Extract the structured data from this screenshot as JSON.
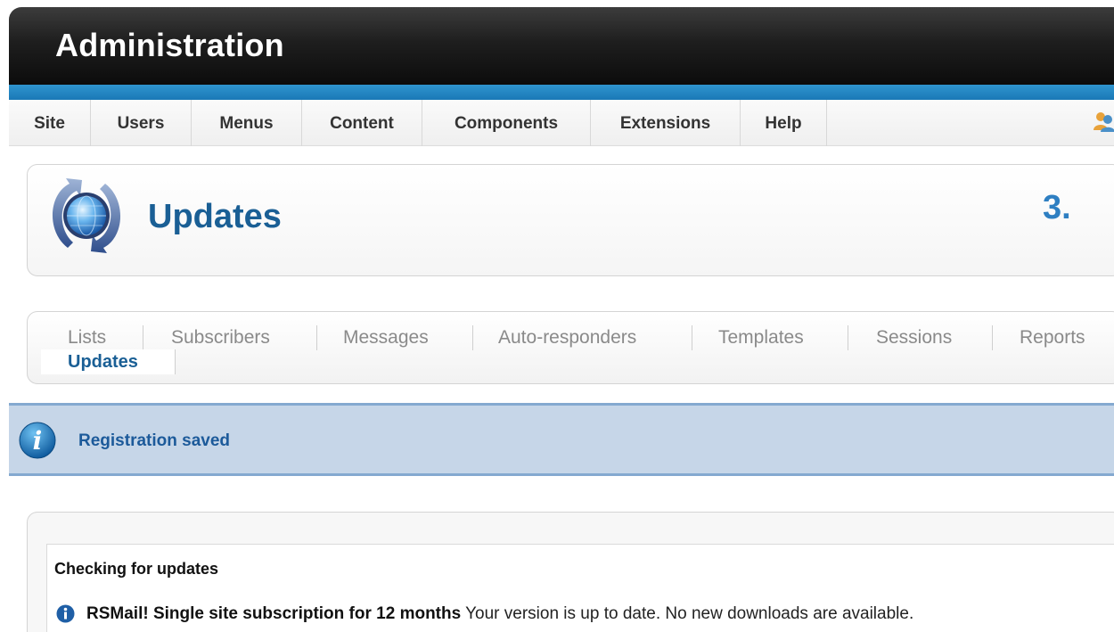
{
  "header": {
    "title": "Administration"
  },
  "menu": {
    "items": [
      {
        "label": "Site"
      },
      {
        "label": "Users"
      },
      {
        "label": "Menus"
      },
      {
        "label": "Content"
      },
      {
        "label": "Components"
      },
      {
        "label": "Extensions"
      },
      {
        "label": "Help"
      }
    ],
    "user_icon": "users-icon"
  },
  "page": {
    "title": "Updates",
    "icon": "updates-globe-icon",
    "version_label": "3."
  },
  "submenu": {
    "tabs": [
      {
        "label": "Lists"
      },
      {
        "label": "Subscribers"
      },
      {
        "label": "Messages"
      },
      {
        "label": "Auto-responders"
      },
      {
        "label": "Templates"
      },
      {
        "label": "Sessions"
      },
      {
        "label": "Reports"
      }
    ],
    "active_tab": "Updates"
  },
  "message": {
    "icon": "info-icon",
    "text": "Registration saved"
  },
  "updates": {
    "heading": "Checking for updates",
    "product": "RSMail! Single site subscription for 12 months",
    "status": " Your version is up to date. No new downloads are available."
  },
  "colors": {
    "accent_blue": "#1a78b6",
    "title_blue": "#1a5f95",
    "message_bg": "#c6d6e8"
  }
}
